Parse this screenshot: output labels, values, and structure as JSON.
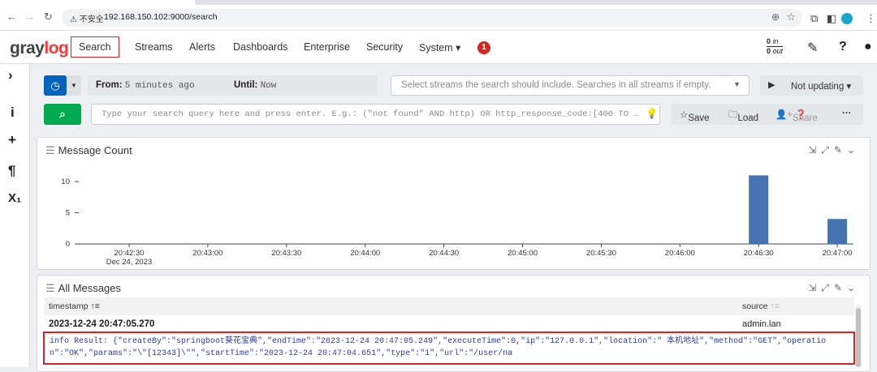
{
  "browser": {
    "security_label": "⚠ 不安全",
    "url": "192.168.150.102:9000/search"
  },
  "navbar": {
    "logo_a": "gray",
    "logo_b": "log",
    "items": [
      "Search",
      "Streams",
      "Alerts",
      "Dashboards",
      "Enterprise",
      "Security",
      "System ▾"
    ],
    "notification_count": "1",
    "throughput_in": "0",
    "throughput_in_unit": "in",
    "throughput_out": "0",
    "throughput_out_unit": "out"
  },
  "search": {
    "from_label": "From:",
    "from_value": "5 minutes ago",
    "until_label": "Until:",
    "until_value": "Now",
    "streams_placeholder": "Select streams the search should include. Searches in all streams if empty.",
    "refresh_label": "Not updating ▾",
    "query_placeholder": "Type your search query here and press enter. E.g.: (\"not found\" AND http) OR http_response_code:[400 TO …",
    "save_label": "Save",
    "load_label": "Load",
    "share_label": "Share"
  },
  "message_count_widget": {
    "title": "Message Count"
  },
  "chart_data": {
    "type": "bar",
    "title": "Message Count",
    "xlabel": "",
    "ylabel": "",
    "x_ticks": [
      "20:42:30",
      "20:43:00",
      "20:43:30",
      "20:44:00",
      "20:44:30",
      "20:45:00",
      "20:45:30",
      "20:46:00",
      "20:46:30",
      "20:47:00"
    ],
    "x_tick_sublabel": "Dec 24, 2023",
    "y_ticks": [
      0,
      5,
      10
    ],
    "ylim": [
      0,
      13
    ],
    "bars": [
      {
        "x": "20:46:30",
        "value": 11
      },
      {
        "x": "20:47:00",
        "value": 4
      }
    ],
    "color": "#4572b0",
    "grid": false
  },
  "messages_widget": {
    "title": "All Messages",
    "col_timestamp": "timestamp",
    "col_source": "source",
    "rows": [
      {
        "timestamp": "2023-12-24 20:47:05.270",
        "source": "admin.lan",
        "message": "info Result: {\"createBy\":\"springboot葵花宝典\",\"endTime\":\"2023-12-24 20:47:05.249\",\"executeTime\":0,\"ip\":\"127.0.0.1\",\"location\":\" 本机地址\",\"method\":\"GET\",\"operation\":\"OK\",\"params\":\"\\\"[12343]\\\"\",\"startTime\":\"2023-12-24 20:47:04.651\",\"type\":\"1\",\"url\":\"/user/na"
      }
    ]
  }
}
